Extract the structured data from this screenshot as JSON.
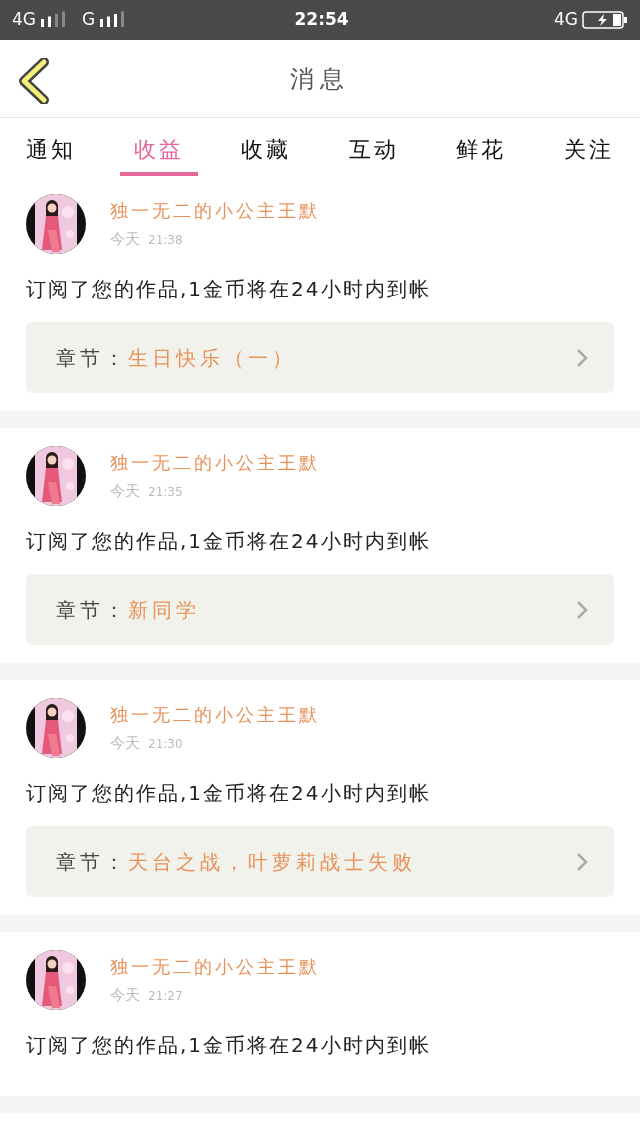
{
  "status_bar": {
    "carrier_1": "4G",
    "carrier_2": "G",
    "time": "22:54",
    "network": "4G"
  },
  "header": {
    "title": "消息"
  },
  "tabs": [
    {
      "label": "通知",
      "selected": false
    },
    {
      "label": "收益",
      "selected": true
    },
    {
      "label": "收藏",
      "selected": false
    },
    {
      "label": "互动",
      "selected": false
    },
    {
      "label": "鲜花",
      "selected": false
    },
    {
      "label": "关注",
      "selected": false
    }
  ],
  "messages": [
    {
      "sender": "独一无二的小公主王默",
      "day": "今天",
      "time": "21:38",
      "text": "订阅了您的作品,1金币将在24小时内到帐",
      "chapter_label": "章节：",
      "chapter": "生日快乐（一）"
    },
    {
      "sender": "独一无二的小公主王默",
      "day": "今天",
      "time": "21:35",
      "text": "订阅了您的作品,1金币将在24小时内到帐",
      "chapter_label": "章节：",
      "chapter": "新同学"
    },
    {
      "sender": "独一无二的小公主王默",
      "day": "今天",
      "time": "21:30",
      "text": "订阅了您的作品,1金币将在24小时内到帐",
      "chapter_label": "章节：",
      "chapter": "天台之战，叶萝莉战士失败"
    },
    {
      "sender": "独一无二的小公主王默",
      "day": "今天",
      "time": "21:27",
      "text": "订阅了您的作品,1金币将在24小时内到帐"
    }
  ]
}
